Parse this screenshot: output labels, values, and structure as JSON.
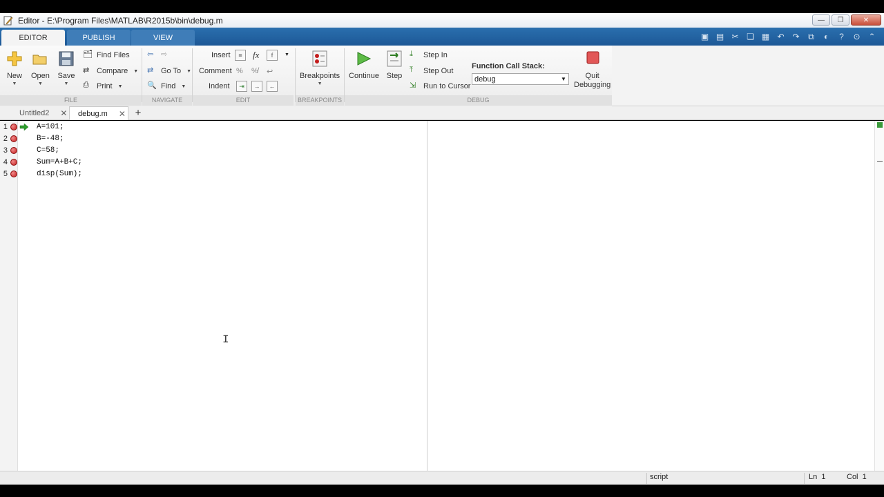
{
  "window": {
    "title": "Editor - E:\\Program Files\\MATLAB\\R2015b\\bin\\debug.m"
  },
  "ribbon_tabs": [
    {
      "label": "EDITOR",
      "active": true
    },
    {
      "label": "PUBLISH",
      "active": false
    },
    {
      "label": "VIEW",
      "active": false
    }
  ],
  "file_group": {
    "label": "FILE",
    "new": "New",
    "open": "Open",
    "save": "Save",
    "find_files": "Find Files",
    "compare": "Compare",
    "print": "Print"
  },
  "navigate_group": {
    "label": "NAVIGATE",
    "go_to": "Go To",
    "find": "Find"
  },
  "edit_group": {
    "label": "EDIT",
    "insert": "Insert",
    "comment": "Comment",
    "indent": "Indent",
    "fx": "fx"
  },
  "breakpoints_group": {
    "label": "BREAKPOINTS",
    "breakpoints": "Breakpoints"
  },
  "debug_group": {
    "label": "DEBUG",
    "continue": "Continue",
    "step": "Step",
    "step_in": "Step In",
    "step_out": "Step Out",
    "run_to_cursor": "Run to Cursor",
    "function_call_stack_label": "Function Call Stack:",
    "function_call_stack_value": "debug",
    "quit_line1": "Quit",
    "quit_line2": "Debugging"
  },
  "doc_tabs": [
    {
      "label": "Untitled2",
      "active": false
    },
    {
      "label": "debug.m",
      "active": true
    }
  ],
  "code_lines": [
    {
      "num": "1",
      "text": "A=101;",
      "breakpoint": true,
      "current": true
    },
    {
      "num": "2",
      "text": "B=-48;",
      "breakpoint": true,
      "current": false
    },
    {
      "num": "3",
      "text": "C=58;",
      "breakpoint": true,
      "current": false
    },
    {
      "num": "4",
      "text": "Sum=A+B+C;",
      "breakpoint": true,
      "current": false
    },
    {
      "num": "5",
      "text": "disp(Sum);",
      "breakpoint": true,
      "current": false
    }
  ],
  "status": {
    "file_type": "script",
    "ln_label": "Ln",
    "ln_value": "1",
    "col_label": "Col",
    "col_value": "1"
  },
  "colors": {
    "ribbon_blue": "#1d5896",
    "breakpoint_red": "#c41d1d",
    "current_line_arrow": "#2e9e2e"
  }
}
